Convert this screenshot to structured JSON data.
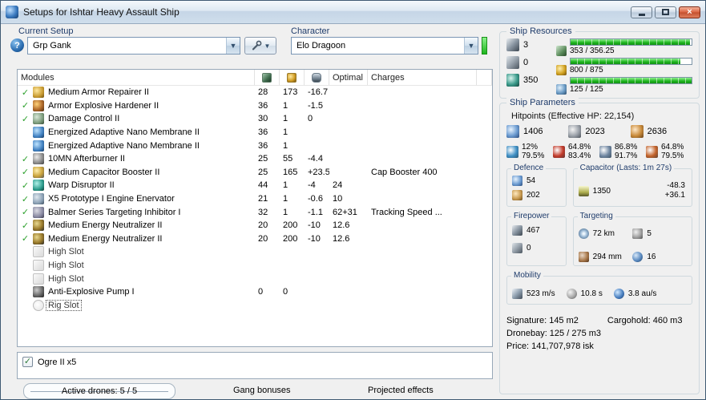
{
  "window": {
    "title": "Setups for Ishtar Heavy Assault Ship"
  },
  "setup": {
    "label": "Current Setup",
    "value": "Grp Gank",
    "help": "?"
  },
  "character": {
    "label": "Character",
    "value": "Elo Dragoon"
  },
  "ship_resources": {
    "title": "Ship Resources",
    "slots": [
      {
        "icon": "turret-hardpoint-icon",
        "value": "3"
      },
      {
        "icon": "launcher-hardpoint-icon",
        "value": "0"
      },
      {
        "icon": "calibration-icon",
        "value": "350"
      }
    ],
    "bars": [
      {
        "icon": "cpu-icon",
        "label": "353 / 356.25",
        "pct": 99
      },
      {
        "icon": "powergrid-icon",
        "label": "800 / 875",
        "pct": 91
      },
      {
        "icon": "drone-bandwidth-icon",
        "label": "125 / 125",
        "pct": 100
      }
    ],
    "bar_fill_color": "#1db41d"
  },
  "modules": {
    "headers": {
      "modules": "Modules",
      "optimal": "Optimal",
      "charges": "Charges"
    },
    "rows": [
      {
        "active": true,
        "icon": "armor-repairer-icon",
        "cls": "ic-rep",
        "name": "Medium Armor Repairer II",
        "cpu": "28",
        "pg": "173",
        "cap": "-16.7",
        "optimal": "",
        "charges": ""
      },
      {
        "active": true,
        "icon": "armor-hardener-icon",
        "cls": "ic-hard",
        "name": "Armor Explosive Hardener II",
        "cpu": "36",
        "pg": "1",
        "cap": "-1.5",
        "optimal": "",
        "charges": ""
      },
      {
        "active": true,
        "icon": "damage-control-icon",
        "cls": "ic-dc",
        "name": "Damage Control II",
        "cpu": "30",
        "pg": "1",
        "cap": "0",
        "optimal": "",
        "charges": ""
      },
      {
        "active": false,
        "icon": "nano-membrane-icon",
        "cls": "ic-mem",
        "name": "Energized Adaptive Nano Membrane II",
        "cpu": "36",
        "pg": "1",
        "cap": "",
        "optimal": "",
        "charges": ""
      },
      {
        "active": false,
        "icon": "nano-membrane-icon",
        "cls": "ic-mem",
        "name": "Energized Adaptive Nano Membrane II",
        "cpu": "36",
        "pg": "1",
        "cap": "",
        "optimal": "",
        "charges": ""
      },
      {
        "active": true,
        "icon": "afterburner-icon",
        "cls": "ic-ab",
        "name": "10MN Afterburner II",
        "cpu": "25",
        "pg": "55",
        "cap": "-4.4",
        "optimal": "",
        "charges": ""
      },
      {
        "active": true,
        "icon": "capacitor-booster-icon",
        "cls": "ic-cb",
        "name": "Medium Capacitor Booster II",
        "cpu": "25",
        "pg": "165",
        "cap": "+23.5",
        "optimal": "",
        "charges": "Cap Booster 400"
      },
      {
        "active": true,
        "icon": "warp-disruptor-icon",
        "cls": "ic-wd",
        "name": "Warp Disruptor II",
        "cpu": "44",
        "pg": "1",
        "cap": "-4",
        "optimal": "24",
        "charges": ""
      },
      {
        "active": true,
        "icon": "stasis-web-icon",
        "cls": "ic-web",
        "name": "X5 Prototype I Engine Enervator",
        "cpu": "21",
        "pg": "1",
        "cap": "-0.6",
        "optimal": "10",
        "charges": ""
      },
      {
        "active": true,
        "icon": "tracking-disruptor-icon",
        "cls": "ic-td",
        "name": "Balmer Series Targeting Inhibitor I",
        "cpu": "32",
        "pg": "1",
        "cap": "-1.1",
        "optimal": "62+31",
        "charges": "Tracking Speed ..."
      },
      {
        "active": true,
        "icon": "energy-neutralizer-icon",
        "cls": "ic-neut",
        "name": "Medium Energy Neutralizer II",
        "cpu": "20",
        "pg": "200",
        "cap": "-10",
        "optimal": "12.6",
        "charges": ""
      },
      {
        "active": true,
        "icon": "energy-neutralizer-icon",
        "cls": "ic-neut",
        "name": "Medium Energy Neutralizer II",
        "cpu": "20",
        "pg": "200",
        "cap": "-10",
        "optimal": "12.6",
        "charges": ""
      },
      {
        "active": false,
        "icon": "empty-high-slot-icon",
        "cls": "ic-slot",
        "name": "High Slot",
        "cpu": "",
        "pg": "",
        "cap": "",
        "optimal": "",
        "charges": "",
        "empty": true
      },
      {
        "active": false,
        "icon": "empty-high-slot-icon",
        "cls": "ic-slot",
        "name": "High Slot",
        "cpu": "",
        "pg": "",
        "cap": "",
        "optimal": "",
        "charges": "",
        "empty": true
      },
      {
        "active": false,
        "icon": "empty-high-slot-icon",
        "cls": "ic-slot",
        "name": "High Slot",
        "cpu": "",
        "pg": "",
        "cap": "",
        "optimal": "",
        "charges": "",
        "empty": true
      },
      {
        "active": false,
        "icon": "armor-rig-icon",
        "cls": "ic-rig",
        "name": "Anti-Explosive Pump I",
        "cpu": "0",
        "pg": "0",
        "cap": "",
        "optimal": "",
        "charges": ""
      },
      {
        "active": false,
        "icon": "empty-rig-slot-icon",
        "cls": "ic-rigslot",
        "name": "Rig Slot",
        "cpu": "",
        "pg": "",
        "cap": "",
        "optimal": "",
        "charges": "",
        "empty": true,
        "focused": true
      }
    ]
  },
  "drones": {
    "items": [
      {
        "checked": true,
        "label": "Ogre II x5"
      }
    ]
  },
  "footer": {
    "active_drones": "Active drones: 5 / 5",
    "gang_bonuses": "Gang bonuses",
    "projected_effects": "Projected effects"
  },
  "ship_parameters": {
    "title": "Ship Parameters",
    "hitpoints_title": "Hitpoints (Effective HP: 22,154)",
    "hp": [
      {
        "icon": "shield-hp-icon",
        "value": "1406"
      },
      {
        "icon": "armor-hp-icon",
        "value": "2023"
      },
      {
        "icon": "structure-hp-icon",
        "value": "2636"
      }
    ],
    "resists": [
      {
        "icon": "em-resist-icon",
        "color": "#3f8fc4",
        "shield": "12%",
        "armor": "79.5%"
      },
      {
        "icon": "thermal-resist-icon",
        "color": "#c23a2a",
        "shield": "64.8%",
        "armor": "83.4%"
      },
      {
        "icon": "kinetic-resist-icon",
        "color": "#6e85a0",
        "shield": "86.8%",
        "armor": "91.7%"
      },
      {
        "icon": "explosive-resist-icon",
        "color": "#c2622a",
        "shield": "64.8%",
        "armor": "79.5%"
      }
    ],
    "defence": {
      "title": "Defence",
      "rows": [
        {
          "icon": "shield-recharge-icon",
          "value": "54"
        },
        {
          "icon": "armor-repair-rate-icon",
          "value": "202"
        }
      ]
    },
    "capacitor": {
      "title": "Capacitor (Lasts: 1m 27s)",
      "icon": "capacitor-icon",
      "amount": "1350",
      "drain": "-48.3",
      "recharge": "+36.1"
    },
    "firepower": {
      "title": "Firepower",
      "rows": [
        {
          "icon": "turret-dps-icon",
          "value": "467"
        },
        {
          "icon": "missile-dps-icon",
          "value": "0"
        }
      ]
    },
    "targeting": {
      "title": "Targeting",
      "cells": [
        {
          "icon": "targeting-range-icon",
          "value": "72 km"
        },
        {
          "icon": "max-targets-icon",
          "value": "5"
        },
        {
          "icon": "scan-resolution-icon",
          "value": "294 mm"
        },
        {
          "icon": "sensor-strength-icon",
          "value": "16"
        }
      ]
    },
    "mobility": {
      "title": "Mobility",
      "cells": [
        {
          "icon": "max-velocity-icon",
          "value": "523 m/s"
        },
        {
          "icon": "align-time-icon",
          "value": "10.8 s"
        },
        {
          "icon": "warp-speed-icon",
          "value": "3.8 au/s"
        }
      ]
    },
    "signature": "Signature: 145 m2",
    "cargohold": "Cargohold: 460 m3",
    "dronebay": "Dronebay: 125 / 275 m3",
    "price": "Price: 141,707,978 isk"
  }
}
